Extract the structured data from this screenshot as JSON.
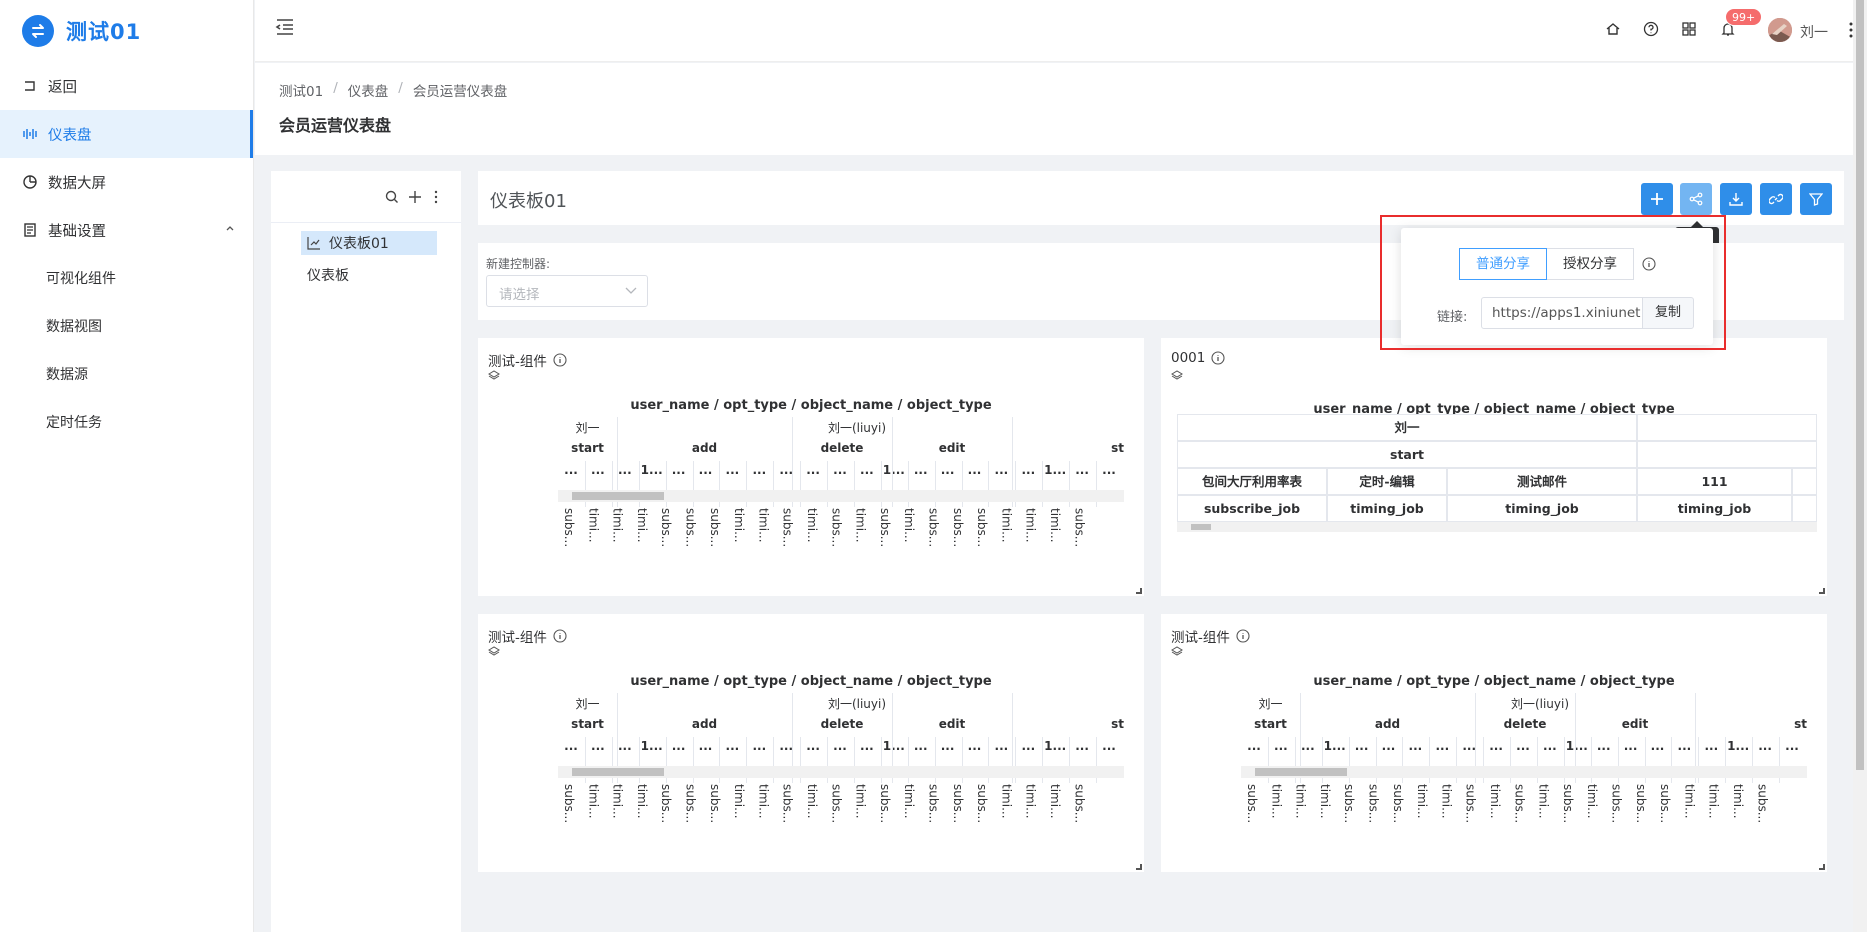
{
  "app": {
    "name": "测试01"
  },
  "sidebar": {
    "items": [
      {
        "label": "返回"
      },
      {
        "label": "仪表盘"
      },
      {
        "label": "数据大屏"
      },
      {
        "label": "基础设置"
      }
    ],
    "subitems": [
      {
        "label": "可视化组件"
      },
      {
        "label": "数据视图"
      },
      {
        "label": "数据源"
      },
      {
        "label": "定时任务"
      }
    ]
  },
  "header": {
    "notification_badge": "99+",
    "username": "刘一"
  },
  "breadcrumb": [
    "测试01",
    "仪表盘",
    "会员运营仪表盘"
  ],
  "page_title": "会员运营仪表盘",
  "tree": {
    "nodes": [
      {
        "label": "仪表板01"
      },
      {
        "label": "仪表板"
      }
    ]
  },
  "dashboard": {
    "title": "仪表板01",
    "tooltip": "分享",
    "controller_label": "新建控制器:",
    "controller_placeholder": "请选择"
  },
  "share": {
    "tab_normal": "普通分享",
    "tab_auth": "授权分享",
    "link_label": "链接:",
    "link_value": "https://apps1.xiniunet",
    "copy_label": "复制"
  },
  "pivot": {
    "title": "user_name / opt_type / object_name / object_type",
    "row1": [
      "刘一",
      "刘一(liuyi)"
    ],
    "row2": [
      "start",
      "add",
      "delete",
      "edit",
      "st"
    ],
    "row3": [
      "...",
      "...",
      "...",
      "1...",
      "...",
      "...",
      "...",
      "...",
      "...",
      "...",
      "...",
      "...",
      "1...",
      "...",
      "...",
      "...",
      "...",
      "...",
      "1...",
      "...",
      "..."
    ],
    "bottom": [
      "subs...",
      "timi...",
      "timi...",
      "timi...",
      "subs...",
      "subs...",
      "subs...",
      "timi...",
      "timi...",
      "subs...",
      "timi...",
      "subs...",
      "timi...",
      "subs...",
      "timi...",
      "subs...",
      "subs...",
      "subs...",
      "timi...",
      "timi...",
      "timi...",
      "subs..."
    ]
  },
  "cards": [
    {
      "title": "测试-组件"
    },
    {
      "title": "0001"
    },
    {
      "title": "测试-组件"
    },
    {
      "title": "测试-组件"
    }
  ],
  "grid": {
    "r1": "刘一",
    "r2": "start",
    "r3": [
      "包间大厅利用率表",
      "定时-编辑",
      "测试邮件",
      "111"
    ],
    "r4": [
      "subscribe_job",
      "timing_job",
      "timing_job",
      "timing_job"
    ]
  }
}
